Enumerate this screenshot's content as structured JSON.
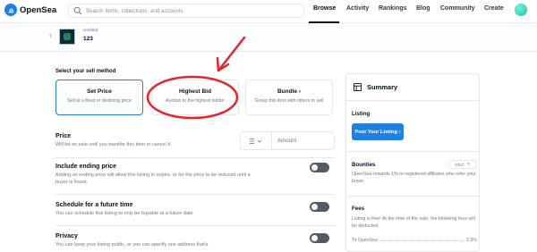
{
  "nav": {
    "brand": "OpenSea",
    "search_placeholder": "Search items, collections, and accounts",
    "links": [
      "Browse",
      "Activity",
      "Rankings",
      "Blog",
      "Community",
      "Create"
    ]
  },
  "item": {
    "collection": "Untitled",
    "name": "123"
  },
  "sell": {
    "method_title": "Select your sell method",
    "methods": [
      {
        "title": "Set Price",
        "subtitle": "Sell at a fixed or declining price"
      },
      {
        "title": "Highest Bid",
        "subtitle": "Auction to the highest bidder"
      },
      {
        "title": "Bundle",
        "subtitle": "Group this item with others to sell"
      }
    ],
    "price_title": "Price",
    "price_desc": "Will be on sale until you transfer this item or cancel it.",
    "amount_placeholder": "Amount",
    "ending_title": "Include ending price",
    "ending_desc": "Adding an ending price will allow this listing to expire, or for the price to be reduced until a buyer is found.",
    "schedule_title": "Schedule for a future time",
    "schedule_desc": "You can schedule this listing to only be buyable at a future date",
    "privacy_title": "Privacy",
    "privacy_desc": "You can keep your listing public, or you can specify one address that's"
  },
  "summary": {
    "title": "Summary",
    "listing_label": "Listing",
    "post_button": "Post Your Listing",
    "bounties_label": "Bounties",
    "edit_label": "EDIT",
    "bounties_text": "OpenSea rewards 1% to registered affiliates who refer your buyer.",
    "fees_label": "Fees",
    "fees_text": "Listing is free! At the time of the sale, the following fees will be deducted.",
    "fee_name": "To OpenSea",
    "fee_value": "2.5%"
  },
  "colors": {
    "accent": "#2081e2",
    "annotation": "#e4252e"
  }
}
